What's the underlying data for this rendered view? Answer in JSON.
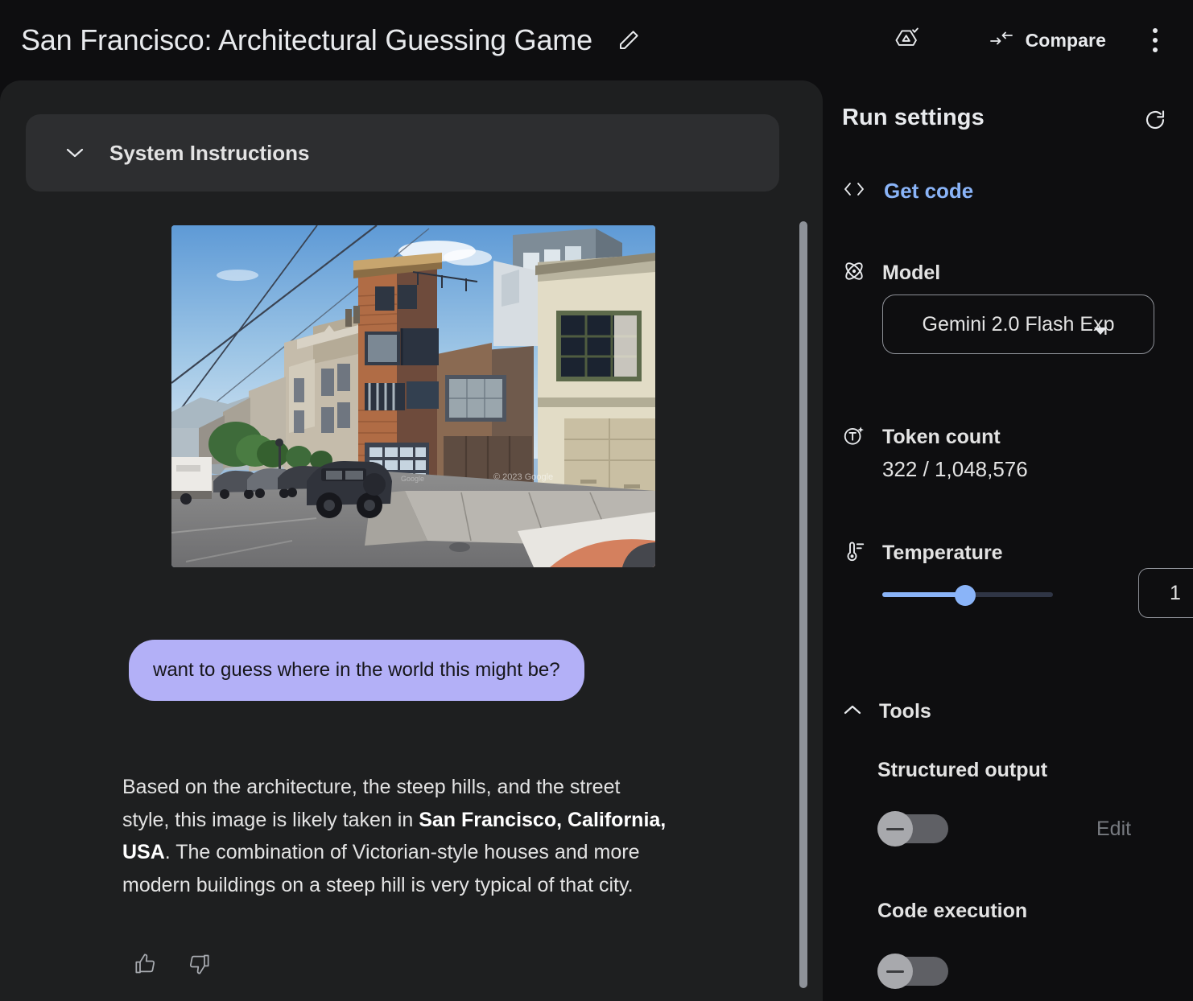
{
  "header": {
    "title": "San Francisco: Architectural Guessing Game",
    "edit_icon": "pencil-icon",
    "drive_icon": "save-to-drive-check-icon",
    "compare_icon": "compare-arrows-icon",
    "compare_label": "Compare",
    "menu_icon": "more-vertical-icon"
  },
  "main": {
    "system_instructions": {
      "label": "System Instructions",
      "chevron_icon": "chevron-down-icon",
      "expanded": false
    },
    "attachment": {
      "name": "street-view-photo",
      "alt": "Street View photo of a steep San Francisco street with Victorian and modern houses",
      "watermark": "© 2023 Google"
    },
    "user_message": "want to guess where in the world this might be?",
    "model_response": {
      "part1": "Based on the architecture, the steep hills, and the street style, this image is likely taken in ",
      "bold": "San Francisco, California, USA",
      "part2": ". The combination of Victorian-style houses and more modern buildings on a steep hill is very typical of that city."
    },
    "feedback": {
      "thumb_up_icon": "thumb-up-icon",
      "thumb_down_icon": "thumb-down-icon"
    }
  },
  "run_settings": {
    "title": "Run settings",
    "refresh_icon": "refresh-icon",
    "get_code": {
      "icon": "code-brackets-icon",
      "label": "Get code"
    },
    "model": {
      "icon": "model-atom-icon",
      "label": "Model",
      "selected": "Gemini 2.0 Flash Exp",
      "caret_icon": "caret-down-icon"
    },
    "token_count": {
      "icon": "token-icon",
      "label": "Token count",
      "value": "322 / 1,048,576"
    },
    "temperature": {
      "icon": "thermometer-icon",
      "label": "Temperature",
      "value": "1",
      "min": 0,
      "max": 2,
      "fill_percent": 50
    },
    "tools": {
      "label": "Tools",
      "chevron_icon": "chevron-up-icon",
      "expanded": true,
      "items": [
        {
          "label": "Structured output",
          "enabled": false,
          "action_label": "Edit"
        },
        {
          "label": "Code execution",
          "enabled": false
        }
      ]
    }
  },
  "colors": {
    "accent_blue": "#8ab4f8",
    "user_bubble": "#b3b0f7",
    "panel_bg": "#1e1f20",
    "page_bg": "#0e0e10",
    "card_bg": "#2d2e30",
    "text": "#e3e3e3"
  }
}
